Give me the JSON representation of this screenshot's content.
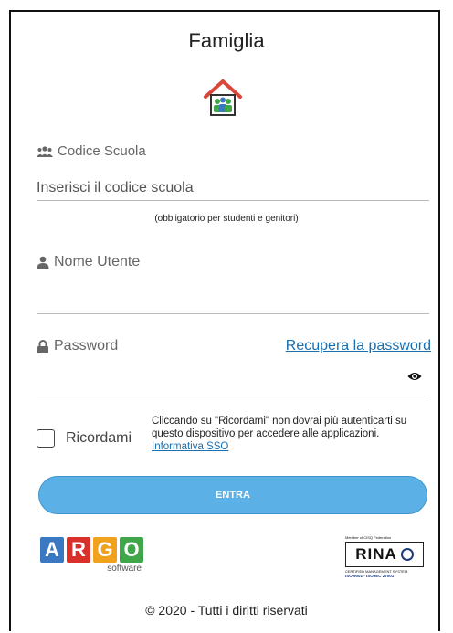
{
  "header": {
    "title": "Famiglia",
    "icon": "house-family-icon"
  },
  "school_code": {
    "label": "Codice Scuola",
    "icon": "users-icon",
    "placeholder": "Inserisci il codice scuola",
    "value": "",
    "hint": "(obbligatorio per studenti e genitori)"
  },
  "username": {
    "label": "Nome Utente",
    "icon": "user-icon",
    "value": ""
  },
  "password": {
    "label": "Password",
    "icon": "lock-icon",
    "recover_link": "Recupera la password",
    "value": "",
    "toggle_icon": "eye-icon"
  },
  "remember": {
    "label": "Ricordami",
    "checked": false,
    "note": "Cliccando su \"Ricordami\" non dovrai più autenticarti su questo dispositivo per accedere alle applicazioni.",
    "link": "Informativa SSO"
  },
  "submit": {
    "label": "ENTRA"
  },
  "logos": {
    "argo": {
      "letters": [
        "A",
        "R",
        "G",
        "O"
      ],
      "colors": [
        "#3a78c2",
        "#d9302a",
        "#f0a21c",
        "#3fa64a"
      ],
      "subtitle": "software"
    },
    "rina": {
      "name": "RINA",
      "top": "Member of CISQ Federation",
      "bottom1": "CERTIFIED MANAGEMENT SYSTEM",
      "bottom2": "ISO 9001 - ISO/IEC 27001"
    }
  },
  "footer": {
    "copyright": "© 2020 - Tutti i diritti riservati"
  },
  "colors": {
    "accent": "#5bb1e6",
    "link": "#1a6fb0"
  }
}
